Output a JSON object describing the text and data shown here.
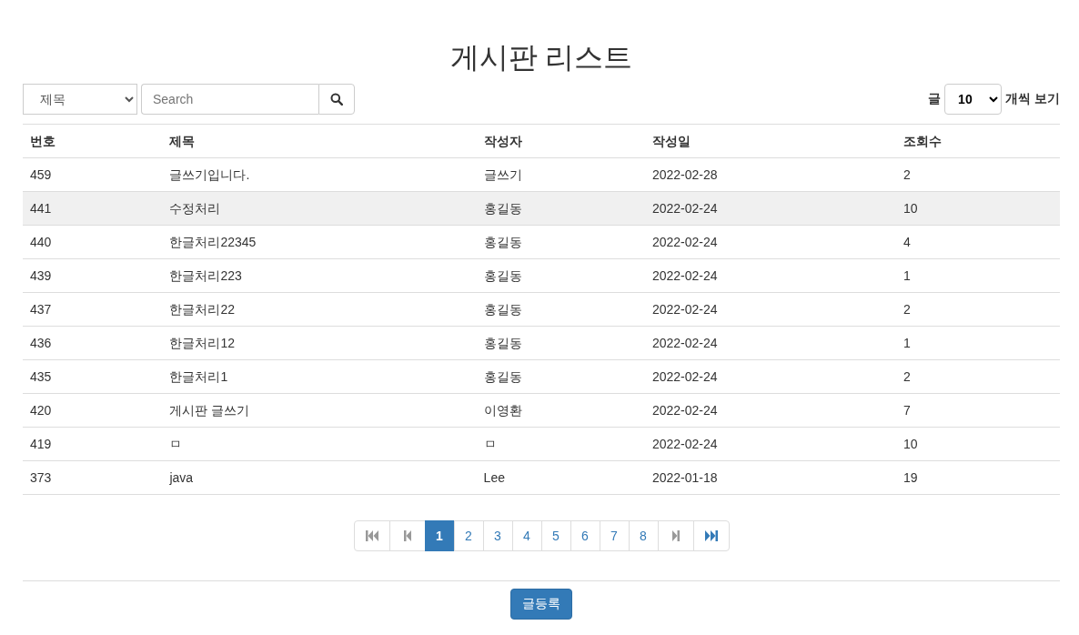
{
  "title": "게시판 리스트",
  "search": {
    "field_option": "제목",
    "placeholder": "Search"
  },
  "page_size": {
    "label_before": "글",
    "value": "10",
    "label_after": "개씩 보기"
  },
  "table": {
    "columns": [
      "번호",
      "제목",
      "작성자",
      "작성일",
      "조회수"
    ],
    "rows": [
      {
        "cells": [
          "459",
          "글쓰기입니다.",
          "글쓰기",
          "2022-02-28",
          "2"
        ],
        "selected": false
      },
      {
        "cells": [
          "441",
          "수정처리",
          "홍길동",
          "2022-02-24",
          "10"
        ],
        "selected": true
      },
      {
        "cells": [
          "440",
          "한글처리22345",
          "홍길동",
          "2022-02-24",
          "4"
        ],
        "selected": false
      },
      {
        "cells": [
          "439",
          "한글처리223",
          "홍길동",
          "2022-02-24",
          "1"
        ],
        "selected": false
      },
      {
        "cells": [
          "437",
          "한글처리22",
          "홍길동",
          "2022-02-24",
          "2"
        ],
        "selected": false
      },
      {
        "cells": [
          "436",
          "한글처리12",
          "홍길동",
          "2022-02-24",
          "1"
        ],
        "selected": false
      },
      {
        "cells": [
          "435",
          "한글처리1",
          "홍길동",
          "2022-02-24",
          "2"
        ],
        "selected": false
      },
      {
        "cells": [
          "420",
          "게시판 글쓰기",
          "이영환",
          "2022-02-24",
          "7"
        ],
        "selected": false
      },
      {
        "cells": [
          "419",
          "ㅁ",
          "ㅁ",
          "2022-02-24",
          "10"
        ],
        "selected": false
      },
      {
        "cells": [
          "373",
          "java",
          "Lee",
          "2022-01-18",
          "19"
        ],
        "selected": false
      }
    ]
  },
  "pagination": [
    {
      "kind": "first",
      "disabled": true
    },
    {
      "kind": "prev",
      "disabled": true
    },
    {
      "kind": "page",
      "label": "1",
      "selected": true
    },
    {
      "kind": "page",
      "label": "2",
      "selected": false
    },
    {
      "kind": "page",
      "label": "3",
      "selected": false
    },
    {
      "kind": "page",
      "label": "4",
      "selected": false
    },
    {
      "kind": "page",
      "label": "5",
      "selected": false
    },
    {
      "kind": "page",
      "label": "6",
      "selected": false
    },
    {
      "kind": "page",
      "label": "7",
      "selected": false
    },
    {
      "kind": "page",
      "label": "8",
      "selected": false
    },
    {
      "kind": "next",
      "disabled": true
    },
    {
      "kind": "last",
      "disabled": false
    }
  ],
  "write_button": "글등록"
}
